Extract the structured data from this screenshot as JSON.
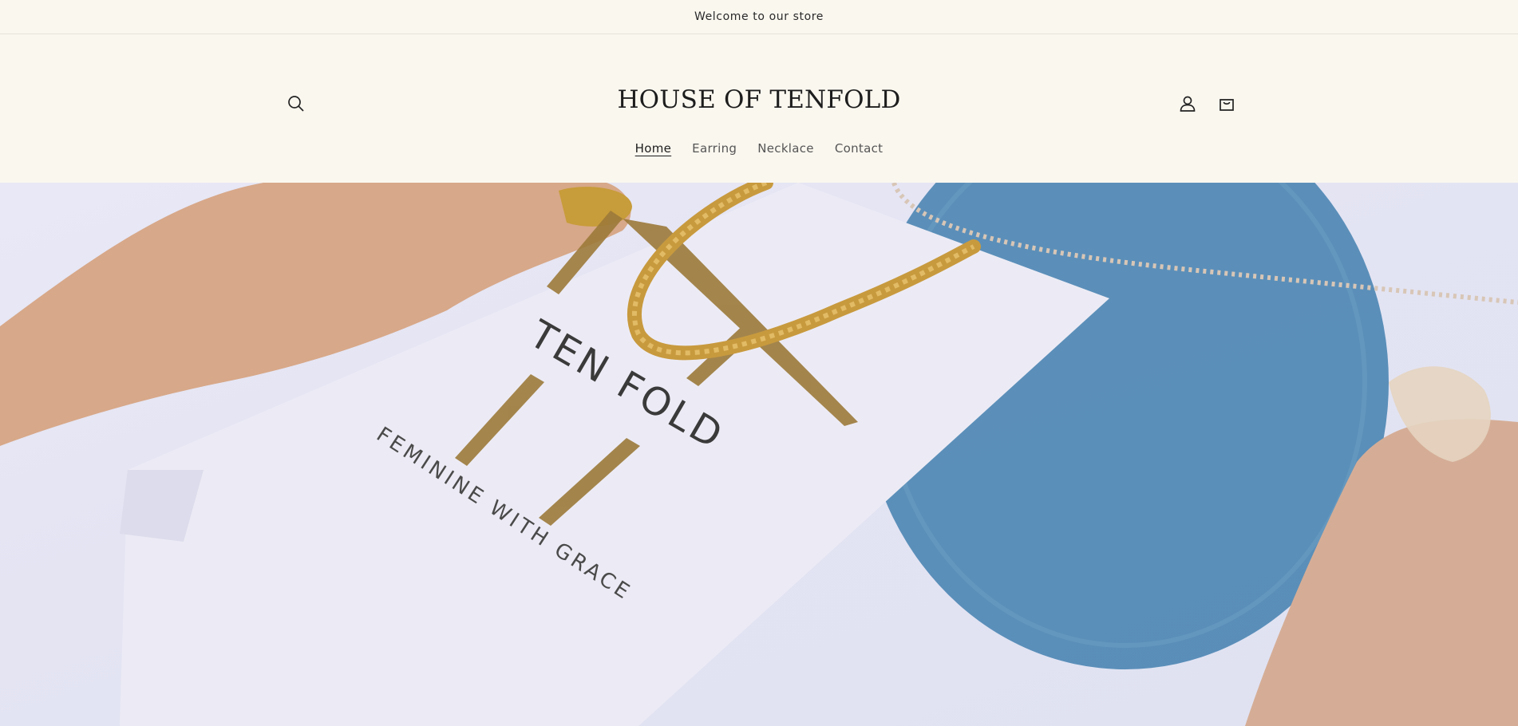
{
  "announcement": {
    "text": "Welcome to our store"
  },
  "header": {
    "logo": "HOUSE OF TENFOLD",
    "icons": {
      "search": "search-icon",
      "account": "user-icon",
      "cart": "shopping-bag-icon"
    }
  },
  "nav": {
    "items": [
      {
        "label": "Home",
        "active": true
      },
      {
        "label": "Earring",
        "active": false
      },
      {
        "label": "Necklace",
        "active": false
      },
      {
        "label": "Contact",
        "active": false
      }
    ]
  },
  "hero": {
    "bag_brand": "TEN FOLD",
    "bag_tagline": "FEMININE WITH GRACE"
  },
  "colors": {
    "background": "#faf7ef",
    "text": "#222222",
    "gold": "#b88a45",
    "plate_blue": "#4b85b2"
  }
}
